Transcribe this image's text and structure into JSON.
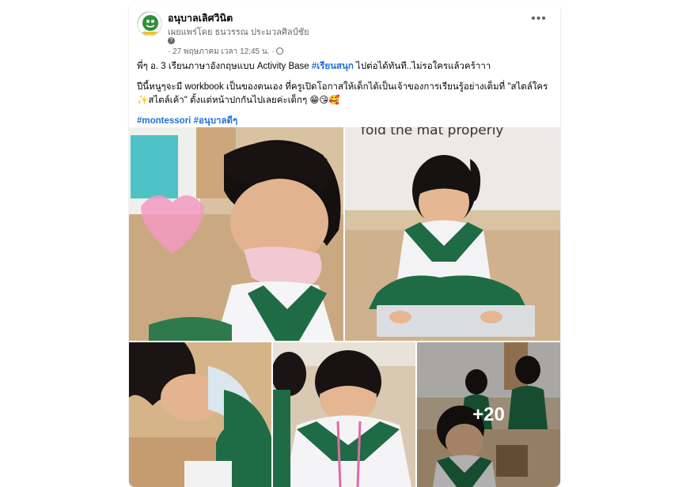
{
  "post": {
    "page_name": "อนุบาลเลิศวินิต",
    "shared_by": "เผยแพร่โดย ธนวรรณ ประมวลศิลป์ชัย",
    "timestamp": "· 27 พฤษภาคม เวลา 12:45 น. ·",
    "more_label": "•••",
    "text_line1": "พี่ๆ อ. 3 เรียนภาษาอังกฤษแบบ Activity Base ",
    "hashtag1": "#เรียนสนุก",
    "text_line1_end": "  ไปต่อได้ทันที..ไม่รอใครแล้วคร้าาา",
    "text_line2": "ปีนี้หนูๆจะมี workbook เป็นของตนเอง ที่ครูเปิดโอกาสให้เด็กได้เป็นเจ้าของการเรียนรู้อย่างเต็มที่ \"สไตล์ใคร ✨สไตล์เค้า\" ตั้งแต่หน้าปกกันไปเลยค่ะเด็กๆ 😁😘🥰",
    "hashtag2": "#montessori",
    "hashtag3": "#อนุบาลดีๆ"
  },
  "photos": {
    "caption_text": "fold the mat properly",
    "more_count": "+20"
  },
  "colors": {
    "link": "#216fdb",
    "secondary_text": "#65676b",
    "uniform_green": "#1f6b45"
  }
}
